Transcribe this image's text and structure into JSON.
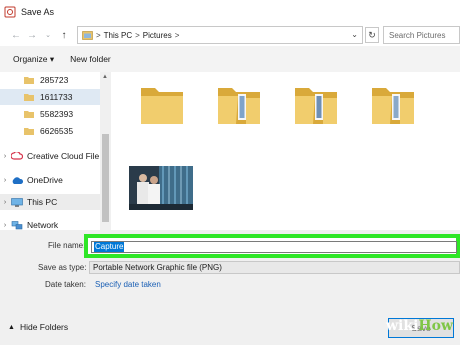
{
  "window": {
    "title": "Save As"
  },
  "nav": {
    "back_icon": "back-arrow-icon",
    "forward_icon": "forward-arrow-icon",
    "recent_icon": "chevron-down-icon",
    "up_icon": "up-arrow-icon"
  },
  "address": {
    "crumbs": [
      "This PC",
      "Pictures"
    ],
    "separator": ">",
    "search_placeholder": "Search Pictures"
  },
  "toolbar": {
    "organize_label": "Organize ▾",
    "new_folder_label": "New folder"
  },
  "sidebar": {
    "folders": [
      {
        "label": "285723"
      },
      {
        "label": "1611733"
      },
      {
        "label": "5582393"
      },
      {
        "label": "6626535"
      }
    ],
    "creative_cloud": "Creative Cloud File",
    "onedrive": "OneDrive",
    "this_pc": "This PC",
    "network": "Network"
  },
  "form": {
    "file_name_label": "File name:",
    "file_name_value": "Capture",
    "save_type_label": "Save as type:",
    "save_type_value": "Portable Network Graphic file (PNG)",
    "date_taken_label": "Date taken:",
    "date_taken_link": "Specify date taken"
  },
  "footer": {
    "hide_folders": "Hide Folders",
    "save_label": "Save"
  },
  "watermark": {
    "part1": "wiki",
    "part2": "How"
  },
  "colors": {
    "folder": "#e8c36a",
    "highlight_green": "#2ee626",
    "selection": "#0078d7",
    "link": "#1a5fb4"
  }
}
